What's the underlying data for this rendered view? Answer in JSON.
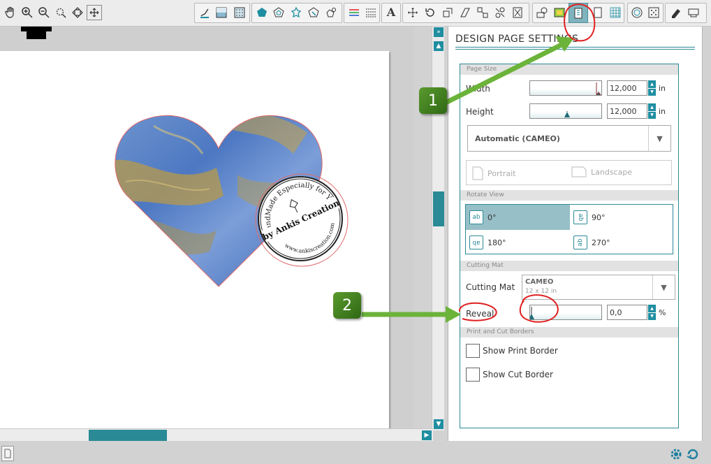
{
  "toolbar": {
    "icons_left": [
      "hand-icon",
      "zoom-in-icon",
      "zoom-out-icon",
      "zoom-selection-icon",
      "zoom-drag-icon",
      "fit-to-window-icon"
    ],
    "icons_right_groups": [
      [
        "line-style-icon",
        "fill-color-icon",
        "fill-pattern-icon"
      ],
      [
        "pentagon-icon",
        "polygon-offset-icon",
        "flower-icon",
        "polygon-edit-icon",
        "polygon-replicate-icon"
      ],
      [
        "color-lines-icon",
        "line-options-icon"
      ],
      [
        "text-icon"
      ],
      [
        "transform-icon",
        "rotate-icon",
        "scale-icon",
        "shear-icon",
        "replicate-icon",
        "nest-icon"
      ],
      [
        "library-icon",
        "media-icon",
        "page-settings-icon",
        "page-layout-icon",
        "grid-icon"
      ],
      [
        "offset-icon",
        "trace-icon"
      ],
      [
        "eraser-icon",
        "send-icon"
      ]
    ]
  },
  "panel": {
    "title": "DESIGN PAGE SETTINGS",
    "page_size": {
      "header": "Page Size",
      "width_label": "Width",
      "width_value": "12,000",
      "height_label": "Height",
      "height_value": "12,000",
      "unit": "in",
      "preset": "Automatic (CAMEO)",
      "portrait_label": "Portrait",
      "landscape_label": "Landscape"
    },
    "rotate_view": {
      "header": "Rotate View",
      "options": [
        "0°",
        "90°",
        "180°",
        "270°"
      ],
      "selected": "0°"
    },
    "cutting_mat": {
      "header": "Cutting Mat",
      "label": "Cutting Mat",
      "selected_name": "CAMEO",
      "selected_size": "12 x 12 in",
      "reveal_label": "Reveal",
      "reveal_value": "0,0",
      "reveal_unit": "%"
    },
    "borders": {
      "header": "Print and Cut Borders",
      "show_print_border": "Show Print Border",
      "show_cut_border": "Show Cut Border"
    }
  },
  "canvas": {
    "stamp_top_text": "HandMade Especially for You",
    "stamp_center_text": "by Ankis Creation",
    "stamp_bottom_text": "www.ankiscreation.com"
  },
  "annotations": {
    "step1": "1",
    "step2": "2",
    "color_arrow": "#5aa02c",
    "color_circle": "#e02020"
  },
  "colors": {
    "accent": "#2b8a96",
    "selected": "#97bfc7",
    "toolbar_active": "#7fb3bd"
  }
}
